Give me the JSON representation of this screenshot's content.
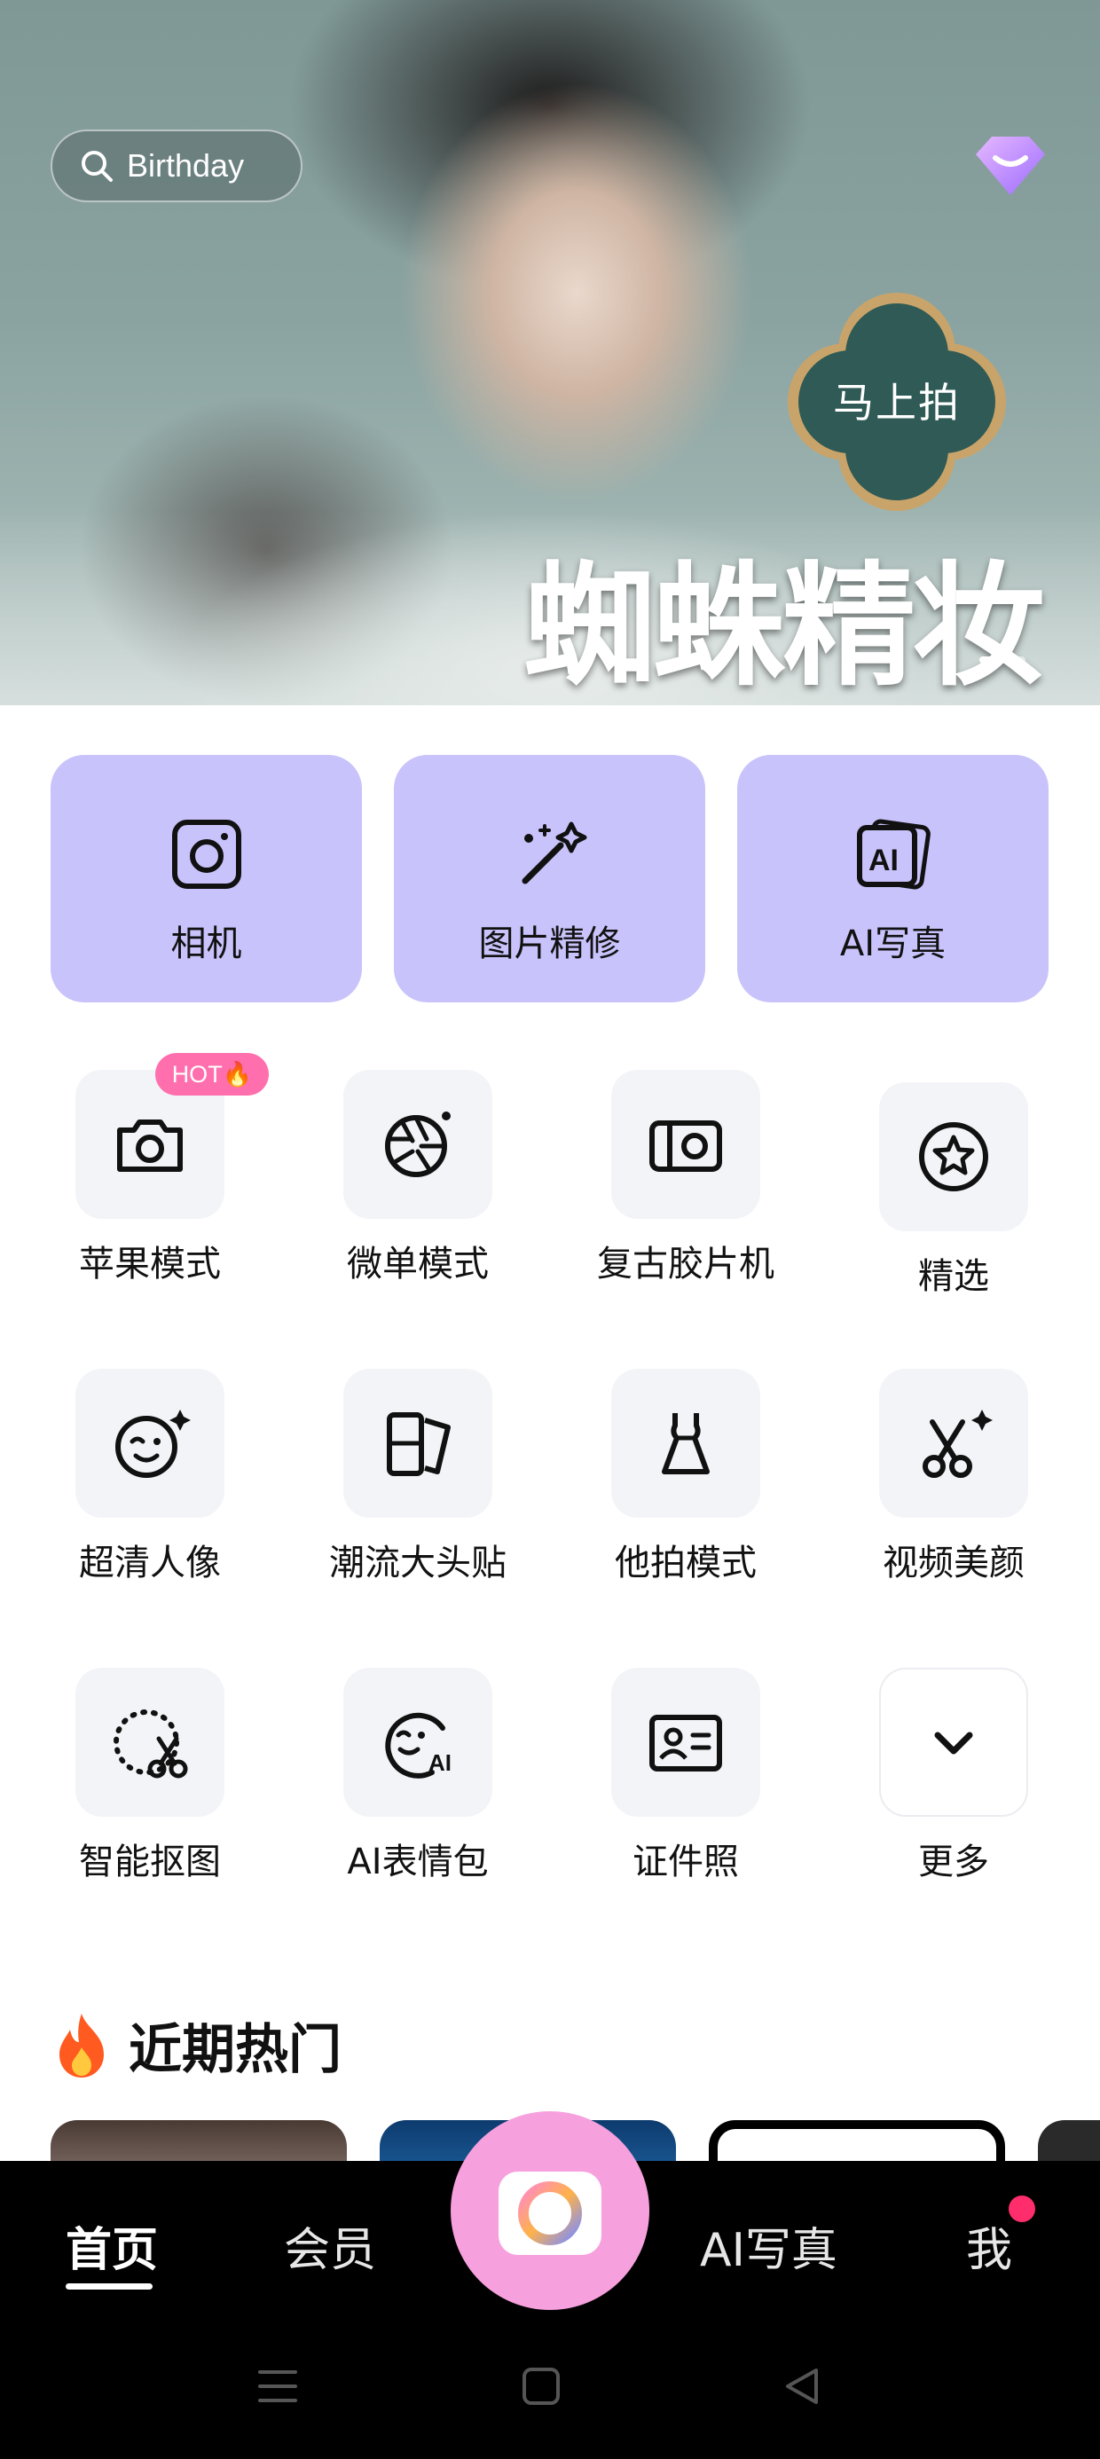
{
  "hero": {
    "search_text": "Birthday",
    "badge_text": "马上拍",
    "title": "蜘蛛精妆"
  },
  "primary_actions": [
    {
      "label": "相机",
      "icon": "camera-frame-icon"
    },
    {
      "label": "图片精修",
      "icon": "magic-wand-icon"
    },
    {
      "label": "AI写真",
      "icon": "ai-portrait-icon"
    }
  ],
  "hot_badge": "HOT🔥",
  "tools": [
    {
      "label": "苹果模式",
      "icon": "camera-icon"
    },
    {
      "label": "微单模式",
      "icon": "aperture-icon"
    },
    {
      "label": "复古胶片机",
      "icon": "film-camera-icon"
    },
    {
      "label": "精选",
      "icon": "star-circle-icon"
    },
    {
      "label": "超清人像",
      "icon": "wink-face-icon"
    },
    {
      "label": "潮流大头贴",
      "icon": "photo-strip-icon"
    },
    {
      "label": "他拍模式",
      "icon": "dress-icon"
    },
    {
      "label": "视频美颜",
      "icon": "scissors-sparkle-icon"
    },
    {
      "label": "智能抠图",
      "icon": "cutout-scissors-icon"
    },
    {
      "label": "AI表情包",
      "icon": "ai-emoji-icon"
    },
    {
      "label": "证件照",
      "icon": "id-card-icon"
    },
    {
      "label": "更多",
      "icon": "chevron-down-icon"
    }
  ],
  "trending": {
    "title": "近期热门",
    "icon": "fire-icon"
  },
  "nav": {
    "home": "首页",
    "vip": "会员",
    "ai_photo": "AI写真",
    "me": "我",
    "center_icon": "camera-shutter-icon"
  },
  "colors": {
    "card_purple": "#c8c3fb",
    "tile_bg": "#f3f4f8",
    "hot_pink": "#ff6fae",
    "center_pink": "#f7a0de",
    "notif_red": "#ff2d6b",
    "nav_bg": "#000000"
  }
}
